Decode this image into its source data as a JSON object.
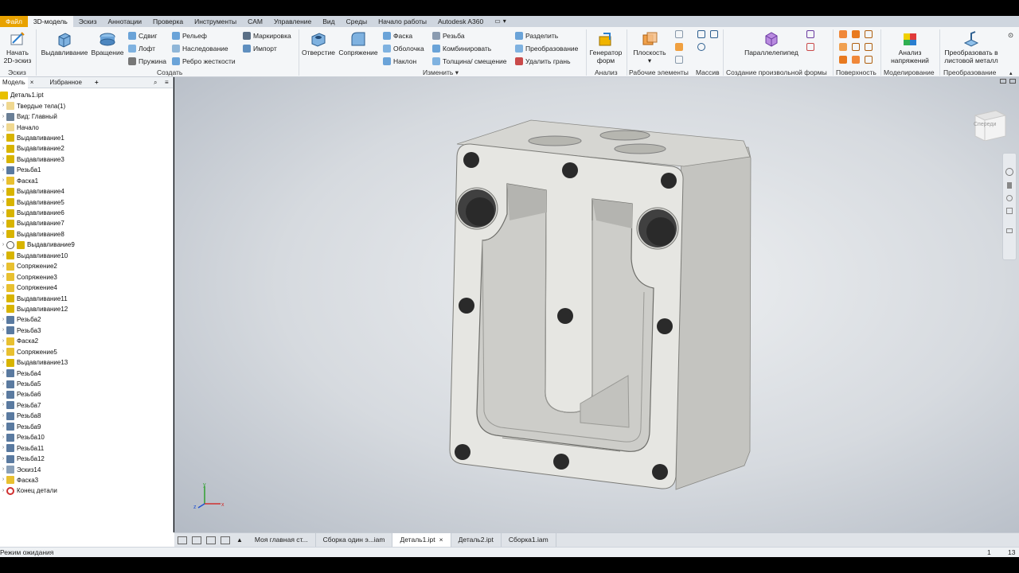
{
  "tabs": {
    "file": "Файл",
    "model3d": "3D-модель",
    "sketch": "Эскиз",
    "annotate": "Аннотации",
    "inspect": "Проверка",
    "tools": "Инструменты",
    "cam": "CAM",
    "manage": "Управление",
    "view": "Вид",
    "environments": "Среды",
    "getstarted": "Начало работы",
    "a360": "Autodesk A360"
  },
  "ribbon": {
    "start_sketch": "Начать",
    "start_sketch2": "2D-эскиз",
    "sketch_group": "Эскиз",
    "extrude": "Выдавливание",
    "revolve": "Вращение",
    "sweep": "Сдвиг",
    "loft": "Лофт",
    "coil": "Пружина",
    "emboss": "Рельеф",
    "derive": "Наследование",
    "rib": "Ребро жесткости",
    "decal": "Маркировка",
    "import": "Импорт",
    "create_group": "Создать",
    "hole": "Отверстие",
    "fillet": "Сопряжение",
    "chamfer": "Фаска",
    "shell": "Оболочка",
    "draft": "Наклон",
    "thread": "Резьба",
    "combine": "Комбинировать",
    "thicken": "Толщина/ смещение",
    "split": "Разделить",
    "direct": "Преобразование",
    "delete_face": "Удалить грань",
    "modify_group": "Изменить",
    "shape_gen1": "Генератор",
    "shape_gen2": "форм",
    "analysis_group": "Анализ",
    "plane": "Плоскость",
    "work_features_group": "Рабочие элементы",
    "pattern_group": "Массив",
    "box": "Параллелепипед",
    "freeform_group": "Создание произвольной формы",
    "surface_group": "Поверхность",
    "stress1": "Анализ",
    "stress2": "напряжений",
    "simulation_group": "Моделирование",
    "convert1": "Преобразовать в",
    "convert2": "листовой металл",
    "convert_group": "Преобразование"
  },
  "panel": {
    "tab_model": "Модель",
    "tab_close": "×",
    "tab_favorites": "Избранное",
    "tab_add": "+"
  },
  "tree": [
    {
      "label": "Деталь1.ipt",
      "icon": "part-icon",
      "level": 0
    },
    {
      "label": "Твердые тела(1)",
      "icon": "folder-icon",
      "level": 1
    },
    {
      "label": "Вид: Главный",
      "icon": "view-rep-icon",
      "level": 1
    },
    {
      "label": "Начало",
      "icon": "folder-icon",
      "level": 1
    },
    {
      "label": "Выдавливание1",
      "icon": "extrude-icon",
      "level": 1
    },
    {
      "label": "Выдавливание2",
      "icon": "extrude-icon",
      "level": 1
    },
    {
      "label": "Выдавливание3",
      "icon": "extrude-icon",
      "level": 1
    },
    {
      "label": "Резьба1",
      "icon": "thread-icon",
      "level": 1
    },
    {
      "label": "Фаска1",
      "icon": "chamfer-icon",
      "level": 1
    },
    {
      "label": "Выдавливание4",
      "icon": "extrude-icon",
      "level": 1
    },
    {
      "label": "Выдавливание5",
      "icon": "extrude-icon",
      "level": 1
    },
    {
      "label": "Выдавливание6",
      "icon": "extrude-icon",
      "level": 1
    },
    {
      "label": "Выдавливание7",
      "icon": "extrude-icon",
      "level": 1
    },
    {
      "label": "Выдавливание8",
      "icon": "extrude-icon",
      "level": 1
    },
    {
      "label": "Выдавливание9",
      "icon": "extrude-icon",
      "level": 2
    },
    {
      "label": "Выдавливание10",
      "icon": "extrude-icon",
      "level": 1
    },
    {
      "label": "Сопряжение2",
      "icon": "fillet-icon",
      "level": 1
    },
    {
      "label": "Сопряжение3",
      "icon": "fillet-icon",
      "level": 1
    },
    {
      "label": "Сопряжение4",
      "icon": "fillet-icon",
      "level": 1
    },
    {
      "label": "Выдавливание11",
      "icon": "extrude-icon",
      "level": 1
    },
    {
      "label": "Выдавливание12",
      "icon": "extrude-icon",
      "level": 1
    },
    {
      "label": "Резьба2",
      "icon": "thread-icon",
      "level": 1
    },
    {
      "label": "Резьба3",
      "icon": "thread-icon",
      "level": 1
    },
    {
      "label": "Фаска2",
      "icon": "chamfer-icon",
      "level": 1
    },
    {
      "label": "Сопряжение5",
      "icon": "fillet-icon",
      "level": 1
    },
    {
      "label": "Выдавливание13",
      "icon": "extrude-icon",
      "level": 1
    },
    {
      "label": "Резьба4",
      "icon": "thread-icon",
      "level": 1
    },
    {
      "label": "Резьба5",
      "icon": "thread-icon",
      "level": 1
    },
    {
      "label": "Резьба6",
      "icon": "thread-icon",
      "level": 1
    },
    {
      "label": "Резьба7",
      "icon": "thread-icon",
      "level": 1
    },
    {
      "label": "Резьба8",
      "icon": "thread-icon",
      "level": 1
    },
    {
      "label": "Резьба9",
      "icon": "thread-icon",
      "level": 1
    },
    {
      "label": "Резьба10",
      "icon": "thread-icon",
      "level": 1
    },
    {
      "label": "Резьба11",
      "icon": "thread-icon",
      "level": 1
    },
    {
      "label": "Резьба12",
      "icon": "thread-icon",
      "level": 1
    },
    {
      "label": "Эскиз14",
      "icon": "sketch-icon",
      "level": 1
    },
    {
      "label": "Фаска3",
      "icon": "chamfer-icon",
      "level": 1
    },
    {
      "label": "Конец детали",
      "icon": "end-of-part-icon",
      "level": 1
    }
  ],
  "viewcube_label": "Спереди",
  "doc_tabs": [
    {
      "label": "Моя главная ст...",
      "active": false
    },
    {
      "label": "Сборка один э...iam",
      "active": false
    },
    {
      "label": "Деталь1.ipt",
      "active": true
    },
    {
      "label": "Деталь2.ipt",
      "active": false
    },
    {
      "label": "Сборка1.iam",
      "active": false
    }
  ],
  "doc_tab_close": "×",
  "status": {
    "text": "Режим ожидания",
    "n1": "1",
    "n2": "13"
  },
  "colors": {
    "file_tab": "#e8a200",
    "extrude_icon": "#d8b400",
    "viewport_center": "#eef0f2",
    "viewport_edge": "#b3bac4",
    "model_face": "#e6e6e2"
  }
}
